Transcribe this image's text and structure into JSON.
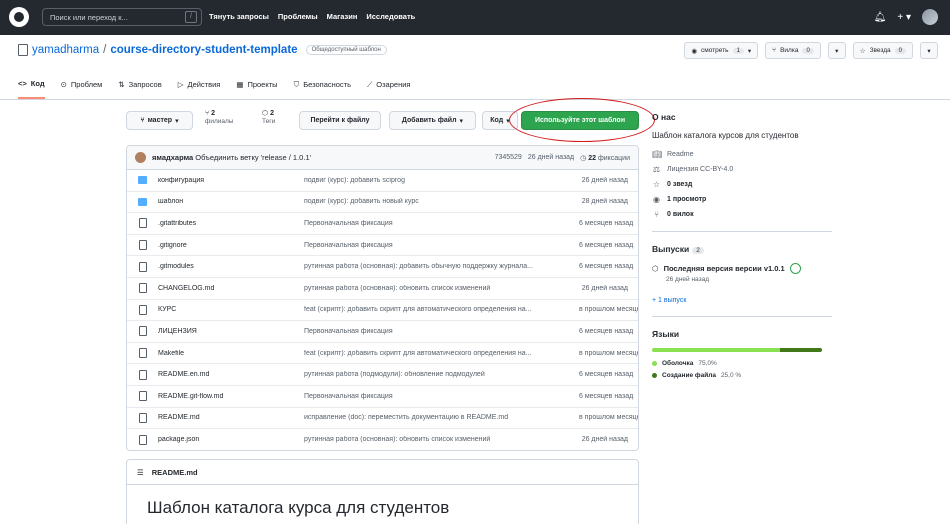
{
  "header": {
    "search_placeholder": "Поиск или переход к...",
    "search_key": "/",
    "nav": [
      "Тянуть запросы",
      "Проблемы",
      "Магазин",
      "Исследовать"
    ],
    "right_icons": [
      "bell-icon",
      "plus-icon",
      "avatar"
    ],
    "plus": "+ ▾"
  },
  "repo": {
    "owner": "yamadharma",
    "separator": "/",
    "name": "course-directory-student-template",
    "visibility": "Общедоступный шаблон",
    "watch": {
      "label": "смотреть",
      "count": "1"
    },
    "fork": {
      "label": "Вилка",
      "count": "0"
    },
    "star": {
      "label": "Звезда",
      "count": "0"
    }
  },
  "tabs": [
    {
      "label": "Код",
      "icon": "<>",
      "active": true
    },
    {
      "label": "Проблем",
      "icon": "⊙"
    },
    {
      "label": "Запросов",
      "icon": "⇅"
    },
    {
      "label": "Действия",
      "icon": "▷"
    },
    {
      "label": "Проекты",
      "icon": "▦"
    },
    {
      "label": "Безопасность",
      "icon": "⛉"
    },
    {
      "label": "Озарения",
      "icon": "⟋"
    }
  ],
  "toolbar": {
    "branch": "мастер",
    "branches_count": "2",
    "branches_label": "филиалы",
    "tags_count": "2",
    "tags_label": "Теги",
    "goto_file": "Перейти к файлу",
    "add_file": "Добавить файл",
    "code": "Код",
    "use_template": "Используйте этот шаблон"
  },
  "commit": {
    "author": "ямадхарма",
    "message": "Объединить ветку 'release / 1.0.1'",
    "hash": "7345529",
    "when": "26 дней назад",
    "commits_count": "22",
    "commits_label": "фиксации"
  },
  "files": [
    {
      "type": "dir",
      "name": "конфигурация",
      "message": "подвиг (курс): добавить sciprog",
      "time": "26 дней назад"
    },
    {
      "type": "dir",
      "name": "шаблон",
      "message": "подвиг (курс): добавить новый курс",
      "time": "28 дней назад"
    },
    {
      "type": "file",
      "name": ".gitattributes",
      "message": "Первоначальная фиксация",
      "time": "6 месяцев назад"
    },
    {
      "type": "file",
      "name": ".gitignore",
      "message": "Первоначальная фиксация",
      "time": "6 месяцев назад"
    },
    {
      "type": "file",
      "name": ".gitmodules",
      "message": "рутинная работа (основная): добавить обычную поддержку журнала...",
      "time": "6 месяцев назад"
    },
    {
      "type": "file",
      "name": "CHANGELOG.md",
      "message": "рутинная работа (основная): обновить список изменений",
      "time": "26 дней назад"
    },
    {
      "type": "file",
      "name": "КУРС",
      "message": "feat (скрипт): добавить скрипт для автоматического определения на...",
      "time": "в прошлом месяце"
    },
    {
      "type": "file",
      "name": "ЛИЦЕНЗИЯ",
      "message": "Первоначальная фиксация",
      "time": "6 месяцев назад"
    },
    {
      "type": "file",
      "name": "Makefile",
      "message": "feat (скрипт): добавить скрипт для автоматического определения на...",
      "time": "в прошлом месяце"
    },
    {
      "type": "file",
      "name": "README.en.md",
      "message": "рутинная работа (подмодули): обновление подмодулей",
      "time": "6 месяцев назад"
    },
    {
      "type": "file",
      "name": "README.git-flow.md",
      "message": "Первоначальная фиксация",
      "time": "6 месяцев назад"
    },
    {
      "type": "file",
      "name": "README.md",
      "message": "исправление (doc): переместить документацию в README.md",
      "time": "в прошлом месяце"
    },
    {
      "type": "file",
      "name": "package.json",
      "message": "рутинная работа (основная): обновить список изменений",
      "time": "26 дней назад"
    }
  ],
  "readme": {
    "filename": "README.md",
    "title": "Шаблон каталога курса для студентов"
  },
  "about": {
    "heading": "О нас",
    "description": "Шаблон каталога курсов для студентов",
    "readme": "Readme",
    "license": "Лицензия CC-BY-4.0",
    "stars": "0 звезд",
    "watching": "1 просмотр",
    "forks": "0 вилок"
  },
  "releases": {
    "heading": "Выпуски",
    "count": "2",
    "latest_title": "Последняя версия версии v1.0.1",
    "latest_date": "26 дней назад",
    "more": "+ 1 выпуск"
  },
  "languages": {
    "heading": "Языки",
    "items": [
      {
        "name": "Оболочка",
        "percent": "75,0%",
        "fraction": 0.75,
        "color": "#89e051"
      },
      {
        "name": "Создание файла",
        "percent": "25,0 %",
        "fraction": 0.25,
        "color": "#427819"
      }
    ]
  }
}
